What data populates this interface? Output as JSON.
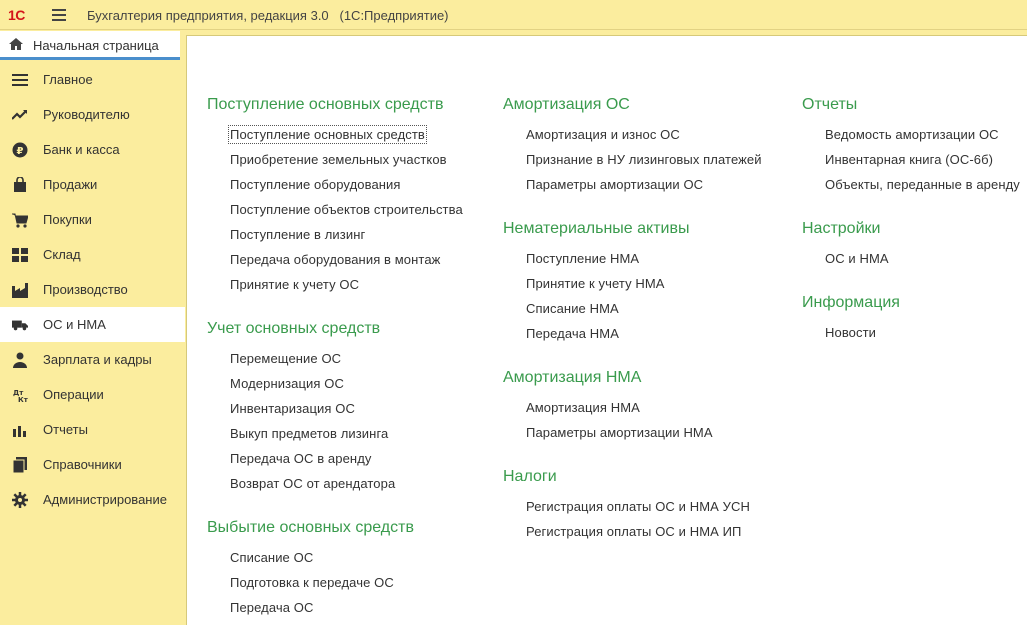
{
  "titlebar": {
    "logo": "1С",
    "title": "Бухгалтерия предприятия, редакция 3.0",
    "platform": "(1С:Предприятие)"
  },
  "home_tab": {
    "label": "Начальная страница"
  },
  "sidebar": {
    "items": [
      {
        "label": "Главное",
        "icon": "list-icon"
      },
      {
        "label": "Руководителю",
        "icon": "trend-icon"
      },
      {
        "label": "Банк и касса",
        "icon": "ruble-icon"
      },
      {
        "label": "Продажи",
        "icon": "bag-icon"
      },
      {
        "label": "Покупки",
        "icon": "cart-icon"
      },
      {
        "label": "Склад",
        "icon": "grid-icon"
      },
      {
        "label": "Производство",
        "icon": "factory-icon"
      },
      {
        "label": "ОС и НМА",
        "icon": "truck-icon",
        "active": true
      },
      {
        "label": "Зарплата и кадры",
        "icon": "person-icon"
      },
      {
        "label": "Операции",
        "icon": "dt-kt-icon"
      },
      {
        "label": "Отчеты",
        "icon": "barchart-icon"
      },
      {
        "label": "Справочники",
        "icon": "books-icon"
      },
      {
        "label": "Администрирование",
        "icon": "gear-icon"
      }
    ]
  },
  "sections": {
    "col1": [
      {
        "title": "Поступление основных средств",
        "links": [
          "Поступление основных средств",
          "Приобретение земельных участков",
          "Поступление оборудования",
          "Поступление объектов строительства",
          "Поступление в лизинг",
          "Передача оборудования в монтаж",
          "Принятие к учету ОС"
        ]
      },
      {
        "title": "Учет основных средств",
        "links": [
          "Перемещение ОС",
          "Модернизация ОС",
          "Инвентаризация ОС",
          "Выкуп предметов лизинга",
          "Передача ОС в аренду",
          "Возврат ОС от арендатора"
        ]
      },
      {
        "title": "Выбытие основных средств",
        "links": [
          "Списание ОС",
          "Подготовка к передаче ОС",
          "Передача ОС"
        ]
      }
    ],
    "col2": [
      {
        "title": "Амортизация ОС",
        "links": [
          "Амортизация и износ ОС",
          "Признание в НУ лизинговых платежей",
          "Параметры амортизации ОС"
        ]
      },
      {
        "title": "Нематериальные активы",
        "links": [
          "Поступление НМА",
          "Принятие к учету НМА",
          "Списание НМА",
          "Передача НМА"
        ]
      },
      {
        "title": "Амортизация НМА",
        "links": [
          "Амортизация НМА",
          "Параметры амортизации НМА"
        ]
      },
      {
        "title": "Налоги",
        "links": [
          "Регистрация оплаты ОС и НМА УСН",
          "Регистрация оплаты ОС и НМА ИП"
        ]
      }
    ],
    "col3": [
      {
        "title": "Отчеты",
        "links": [
          "Ведомость амортизации ОС",
          "Инвентарная книга (ОС-6б)",
          "Объекты, переданные в аренду"
        ]
      },
      {
        "title": "Настройки",
        "links": [
          "ОС и НМА"
        ]
      },
      {
        "title": "Информация",
        "links": [
          "Новости"
        ]
      }
    ]
  },
  "colors": {
    "accent": "#3a9b4d",
    "sidebar_bg": "#fbed9e",
    "logo": "#d4151b"
  }
}
